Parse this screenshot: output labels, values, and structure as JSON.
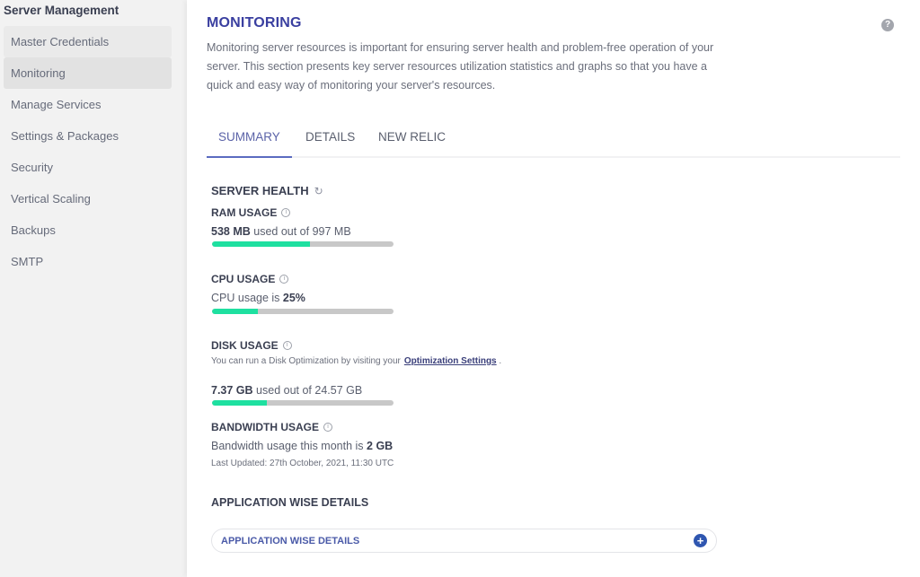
{
  "sidebar": {
    "title": "Server Management",
    "items": [
      {
        "label": "Master Credentials"
      },
      {
        "label": "Monitoring"
      },
      {
        "label": "Manage Services"
      },
      {
        "label": "Settings & Packages"
      },
      {
        "label": "Security"
      },
      {
        "label": "Vertical Scaling"
      },
      {
        "label": "Backups"
      },
      {
        "label": "SMTP"
      }
    ],
    "active_item": "Monitoring"
  },
  "header": {
    "title": "MONITORING",
    "help_icon": "?",
    "description": "Monitoring server resources is important for ensuring server health and problem-free operation of your server. This section presents key server resources utilization statistics and graphs so that you have a quick and easy way of monitoring your server's resources."
  },
  "tabs": [
    {
      "label": "SUMMARY",
      "active": true
    },
    {
      "label": "DETAILS",
      "active": false
    },
    {
      "label": "NEW RELIC",
      "active": false
    }
  ],
  "server_health": {
    "title": "SERVER HEALTH",
    "refresh_icon": "↻",
    "ram": {
      "label": "RAM USAGE",
      "used": "538 MB",
      "text": " used out of 997 MB",
      "fraction": 0.54
    },
    "cpu": {
      "label": "CPU USAGE",
      "text": "CPU usage is ",
      "value": "25%",
      "fraction": 0.25
    },
    "disk": {
      "label": "DISK USAGE",
      "hint": "You can run a Disk Optimization by visiting your",
      "link": "Optimization Settings",
      "hint_end": " .",
      "used": "7.37 GB",
      "text": " used out of 24.57 GB",
      "fraction": 0.3
    },
    "bandwidth": {
      "label": "BANDWIDTH USAGE",
      "text": "Bandwidth usage this month is ",
      "value": "2 GB",
      "updated": "Last Updated: 27th October, 2021, 11:30 UTC"
    }
  },
  "app_details": {
    "title": "APPLICATION WISE DETAILS",
    "accordion_label": "APPLICATION WISE DETAILS",
    "plus_icon": "+"
  },
  "colors": {
    "accent": "#3a3fa0",
    "progress": "#1ee0a0",
    "track": "#c8c8c8",
    "plus": "#2f56b0"
  }
}
